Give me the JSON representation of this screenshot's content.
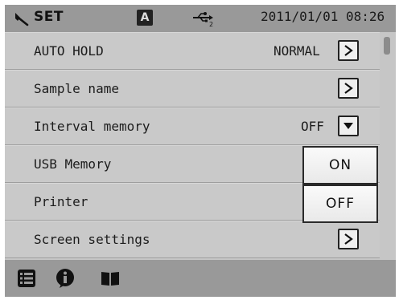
{
  "header": {
    "icon_tool": "wrench-icon",
    "title": "SET",
    "mode_badge": "A",
    "usb_icon": "usb-icon",
    "usb_port": "2",
    "datetime": "2011/01/01 08:26"
  },
  "rows": [
    {
      "label": "AUTO HOLD",
      "value": "NORMAL",
      "control": "arrow-right"
    },
    {
      "label": "Sample name",
      "value": "",
      "control": "arrow-right"
    },
    {
      "label": "Interval memory",
      "value": "OFF",
      "control": "dropdown"
    },
    {
      "label": "USB Memory",
      "value": "",
      "control": ""
    },
    {
      "label": "Printer",
      "value": "",
      "control": ""
    },
    {
      "label": "Screen settings",
      "value": "",
      "control": "arrow-right"
    }
  ],
  "popup": {
    "options": [
      "ON",
      "OFF"
    ]
  },
  "footer": {
    "icons": [
      "list-icon",
      "info-icon",
      "book-icon"
    ]
  }
}
